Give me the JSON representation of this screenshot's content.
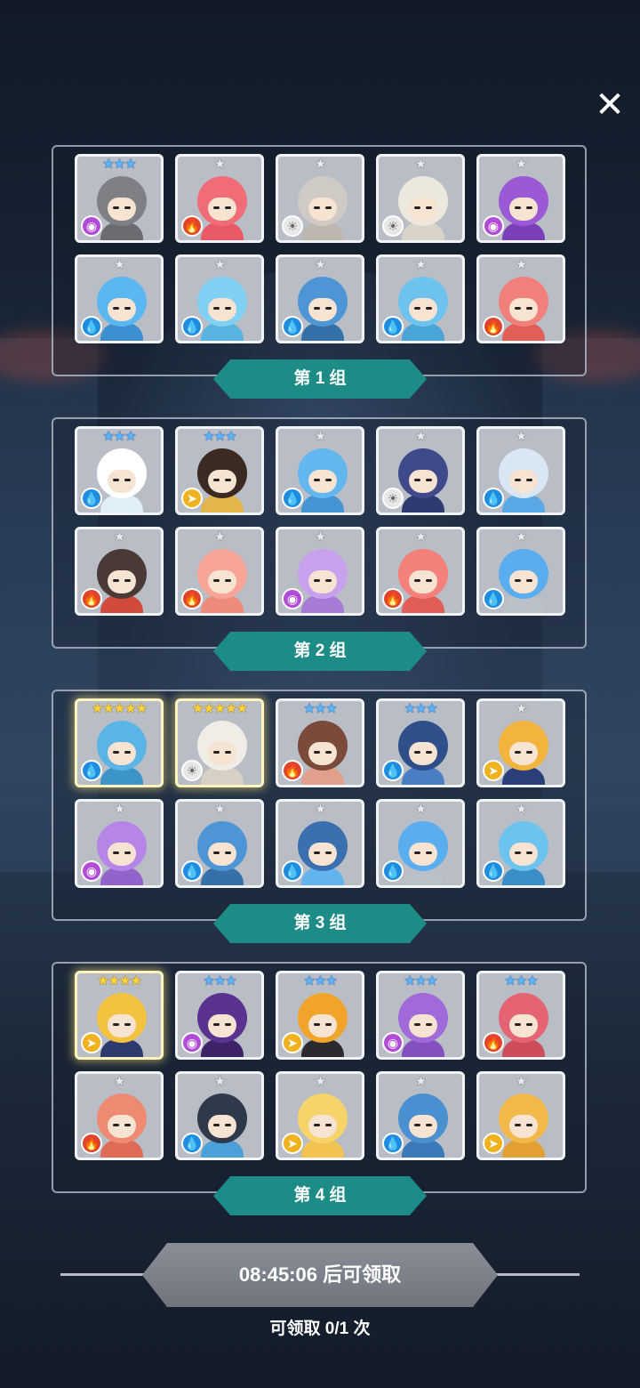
{
  "close_button": "✕",
  "star_glyph": "★",
  "element_symbols": {
    "water": "💧",
    "fire": "🔥",
    "light": "☀",
    "dark": "◉",
    "wind": "➤"
  },
  "groups": [
    {
      "label": "第 1 组",
      "heroes": [
        {
          "stars": 3,
          "star_color": "blue",
          "element": "dark",
          "head": "#7f7f86",
          "body": "#6b6b72",
          "icon": "knight-icon"
        },
        {
          "stars": 1,
          "star_color": "grey",
          "element": "fire",
          "head": "#f06d78",
          "body": "#e95a66",
          "icon": "spiky-creature-icon"
        },
        {
          "stars": 1,
          "star_color": "grey",
          "element": "light",
          "head": "#cfcac4",
          "body": "#bdb7b0",
          "icon": "spiky-creature-icon"
        },
        {
          "stars": 1,
          "star_color": "grey",
          "element": "light",
          "head": "#ece8dd",
          "body": "#d9d4c7",
          "icon": "mummy-icon"
        },
        {
          "stars": 1,
          "star_color": "grey",
          "element": "dark",
          "head": "#9b59d6",
          "body": "#7c3fb9",
          "icon": "skull-icon"
        },
        {
          "stars": 1,
          "star_color": "grey",
          "element": "water",
          "head": "#5bb7ef",
          "body": "#3d8fcf",
          "icon": "cat-icon"
        },
        {
          "stars": 1,
          "star_color": "grey",
          "element": "water",
          "head": "#7fd0f2",
          "body": "#5ab2e0",
          "icon": "mage-icon"
        },
        {
          "stars": 1,
          "star_color": "grey",
          "element": "water",
          "head": "#4d95d4",
          "body": "#3471a8",
          "icon": "witch-icon"
        },
        {
          "stars": 1,
          "star_color": "grey",
          "element": "water",
          "head": "#6ec3ee",
          "body": "#4aa6d8",
          "icon": "moai-icon"
        },
        {
          "stars": 1,
          "star_color": "grey",
          "element": "fire",
          "head": "#f2807a",
          "body": "#e25f58",
          "icon": "girl-icon"
        }
      ]
    },
    {
      "label": "第 2 组",
      "heroes": [
        {
          "stars": 3,
          "star_color": "blue",
          "element": "water",
          "head": "#ffffff",
          "body": "#e0eef8",
          "icon": "rabbit-icon"
        },
        {
          "stars": 3,
          "star_color": "blue",
          "element": "wind",
          "head": "#3a2a22",
          "body": "#e2b64a",
          "icon": "warrior-icon"
        },
        {
          "stars": 1,
          "star_color": "grey",
          "element": "water",
          "head": "#62b7ee",
          "body": "#4594d3",
          "icon": "cactus-icon"
        },
        {
          "stars": 1,
          "star_color": "grey",
          "element": "light",
          "head": "#3e4a8a",
          "body": "#2f3a70",
          "icon": "skull-icon"
        },
        {
          "stars": 1,
          "star_color": "grey",
          "element": "water",
          "head": "#d9e6f4",
          "body": "#5aa9e6",
          "icon": "slime-icon"
        },
        {
          "stars": 1,
          "star_color": "grey",
          "element": "fire",
          "head": "#4a3a36",
          "body": "#d24a3c",
          "icon": "knight-icon"
        },
        {
          "stars": 1,
          "star_color": "grey",
          "element": "fire",
          "head": "#f7a596",
          "body": "#ee8a7a",
          "icon": "flower-girl-icon"
        },
        {
          "stars": 1,
          "star_color": "grey",
          "element": "dark",
          "head": "#c7a0ee",
          "body": "#a57bd6",
          "icon": "flower-girl-icon"
        },
        {
          "stars": 1,
          "star_color": "grey",
          "element": "fire",
          "head": "#f4807a",
          "body": "#e05e56",
          "icon": "horned-girl-icon"
        },
        {
          "stars": 1,
          "star_color": "grey",
          "element": "water",
          "head": "#5aaef0",
          "body": "#b9c0c8",
          "icon": "winged-knight-icon"
        }
      ]
    },
    {
      "label": "第 3 组",
      "heroes": [
        {
          "stars": 5,
          "star_color": "gold",
          "element": "water",
          "head": "#5bb4e6",
          "body": "#3d94c8",
          "icon": "lion-icon",
          "gold": true
        },
        {
          "stars": 5,
          "star_color": "gold",
          "element": "light",
          "head": "#f0ede6",
          "body": "#d7d1c5",
          "icon": "white-hair-icon",
          "gold": true
        },
        {
          "stars": 3,
          "star_color": "blue",
          "element": "fire",
          "head": "#7a4a3a",
          "body": "#e0a08c",
          "icon": "horned-king-icon"
        },
        {
          "stars": 3,
          "star_color": "blue",
          "element": "water",
          "head": "#2f4f8a",
          "body": "#4b7fc4",
          "icon": "hooded-icon"
        },
        {
          "stars": 1,
          "star_color": "grey",
          "element": "wind",
          "head": "#f2b43c",
          "body": "#2b3f78",
          "icon": "skull-icon"
        },
        {
          "stars": 1,
          "star_color": "grey",
          "element": "dark",
          "head": "#b586e8",
          "body": "#9363cc",
          "icon": "cat-girl-icon"
        },
        {
          "stars": 1,
          "star_color": "grey",
          "element": "water",
          "head": "#4d95d4",
          "body": "#3471a8",
          "icon": "witch-icon"
        },
        {
          "stars": 1,
          "star_color": "grey",
          "element": "water",
          "head": "#3a6fb0",
          "body": "#62b3ee",
          "icon": "pixel-icon"
        },
        {
          "stars": 1,
          "star_color": "grey",
          "element": "water",
          "head": "#5aaef0",
          "body": "#b9c0c8",
          "icon": "winged-knight-icon"
        },
        {
          "stars": 1,
          "star_color": "grey",
          "element": "water",
          "head": "#6cc3ee",
          "body": "#3c8ec9",
          "icon": "chest-icon"
        }
      ]
    },
    {
      "label": "第 4 组",
      "heroes": [
        {
          "stars": 4,
          "star_color": "gold",
          "element": "wind",
          "head": "#f3c340",
          "body": "#2d3a6e",
          "icon": "hooded-icon",
          "gold": true
        },
        {
          "stars": 3,
          "star_color": "blue",
          "element": "dark",
          "head": "#5a3390",
          "body": "#3e2366",
          "icon": "ninja-icon"
        },
        {
          "stars": 3,
          "star_color": "blue",
          "element": "wind",
          "head": "#f0a52a",
          "body": "#2b2a2f",
          "icon": "sun-mask-icon"
        },
        {
          "stars": 3,
          "star_color": "blue",
          "element": "dark",
          "head": "#a26ad8",
          "body": "#8450c0",
          "icon": "queen-icon"
        },
        {
          "stars": 3,
          "star_color": "blue",
          "element": "fire",
          "head": "#e46474",
          "body": "#cc4c5c",
          "icon": "robot-icon"
        },
        {
          "stars": 1,
          "star_color": "grey",
          "element": "fire",
          "head": "#ee8a72",
          "body": "#e06c58",
          "icon": "sausage-icon"
        },
        {
          "stars": 1,
          "star_color": "grey",
          "element": "water",
          "head": "#2e3a4a",
          "body": "#4ba0d8",
          "icon": "helmet-boy-icon"
        },
        {
          "stars": 1,
          "star_color": "grey",
          "element": "wind",
          "head": "#f6d46a",
          "body": "#f2c350",
          "icon": "horned-girl-icon"
        },
        {
          "stars": 1,
          "star_color": "grey",
          "element": "water",
          "head": "#4a8fd0",
          "body": "#3b79b8",
          "icon": "statue-icon"
        },
        {
          "stars": 1,
          "star_color": "grey",
          "element": "wind",
          "head": "#f2b84a",
          "body": "#e2a032",
          "icon": "bandaged-beast-icon"
        }
      ]
    }
  ],
  "claim": {
    "timer_text": "08:45:06 后可领取",
    "count_text": "可领取 0/1 次"
  }
}
